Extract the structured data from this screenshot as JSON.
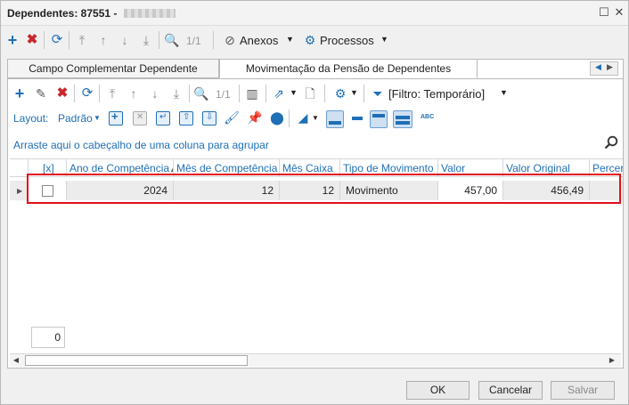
{
  "window": {
    "title": "Dependentes: 87551 -"
  },
  "toolbar": {
    "page_indicator": "1/1",
    "anexos_label": "Anexos",
    "processos_label": "Processos"
  },
  "tabs": [
    {
      "label": "Campo Complementar Dependente"
    },
    {
      "label": "Movimentação da Pensão de Dependentes"
    }
  ],
  "inner_toolbar": {
    "page_indicator": "1/1",
    "filter_label": "[Filtro: Temporário]",
    "layout_label": "Layout:",
    "layout_value": "Padrão",
    "abc_label": "ABC"
  },
  "grid": {
    "group_hint": "Arraste aqui o cabeçalho de uma coluna para agrupar",
    "columns": [
      "[x]",
      "Ano de Competência",
      "Mês de Competência",
      "Mês Caixa",
      "Tipo de Movimento",
      "Valor",
      "Valor Original",
      "Percer"
    ],
    "rows": [
      {
        "ano": "2024",
        "mes": "12",
        "mes_caixa": "12",
        "tipo": "Movimento",
        "valor": "457,00",
        "valor_original": "456,49",
        "percer": ""
      }
    ],
    "footer_count": "0"
  },
  "buttons": {
    "ok": "OK",
    "cancel": "Cancelar",
    "save": "Salvar"
  },
  "colors": {
    "accent_blue": "#1f6fb5",
    "delete_red": "#c8282b",
    "highlight_red": "#e0101a"
  }
}
